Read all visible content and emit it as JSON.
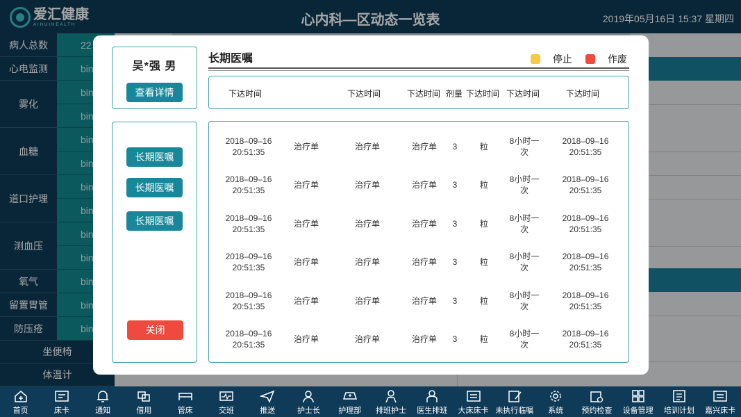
{
  "header": {
    "logo_cn": "爱汇健康",
    "logo_en": "AIHUIHEALTH",
    "title": "心内科—区动态一览表",
    "datetime": "2019年05月16日 15:37 星期四"
  },
  "left_menu": {
    "rows": [
      {
        "label": "病人总数",
        "values": [
          "22"
        ]
      },
      {
        "label": "心电监测",
        "values": [
          "bin"
        ]
      },
      {
        "label": "雾化",
        "values": [
          "bin",
          "bin"
        ]
      },
      {
        "label": "血糖",
        "values": [
          "bin",
          "bin"
        ]
      },
      {
        "label": "道口护理",
        "values": [
          "bin",
          "bin"
        ]
      },
      {
        "label": "测血压",
        "values": [
          "bin",
          "bin"
        ]
      },
      {
        "label": "氧气",
        "values": [
          "bin"
        ]
      },
      {
        "label": "留置胃管",
        "values": [
          "bin"
        ]
      },
      {
        "label": "防压疮",
        "values": [
          "bin"
        ]
      }
    ],
    "wide_rows": [
      "坐便椅",
      "体温计"
    ]
  },
  "modal": {
    "patient": "吴*强  男",
    "detail_button": "查看详情",
    "side_buttons": [
      "长期医嘱",
      "长期医嘱",
      "长期医嘱"
    ],
    "close_button": "关闭",
    "section_title": "长期医嘱",
    "legend": [
      {
        "label": "停止",
        "color": "#f7c948"
      },
      {
        "label": "作废",
        "color": "#ee4a3e"
      }
    ],
    "columns": [
      "下达时间",
      "下达时间",
      "下达时间",
      "剂量",
      "下达时间",
      "下达时间",
      "下达时间"
    ],
    "rows": [
      {
        "c1a": "2018–09–16",
        "c1b": "20:51:35",
        "c2": "治疗单",
        "c3": "治疗单",
        "c4": "治疗单",
        "c5": "3",
        "c6": "粒",
        "c7a": "8小时一",
        "c7b": "次",
        "c8a": "2018–09–16",
        "c8b": "20:51:35"
      },
      {
        "c1a": "2018–09–16",
        "c1b": "20:51:35",
        "c2": "治疗单",
        "c3": "治疗单",
        "c4": "治疗单",
        "c5": "3",
        "c6": "粒",
        "c7a": "8小时一",
        "c7b": "次",
        "c8a": "2018–09–16",
        "c8b": "20:51:35"
      },
      {
        "c1a": "2018–09–16",
        "c1b": "20:51:35",
        "c2": "治疗单",
        "c3": "治疗单",
        "c4": "治疗单",
        "c5": "3",
        "c6": "粒",
        "c7a": "8小时一",
        "c7b": "次",
        "c8a": "2018–09–16",
        "c8b": "20:51:35"
      },
      {
        "c1a": "2018–09–16",
        "c1b": "20:51:35",
        "c2": "治疗单",
        "c3": "治疗单",
        "c4": "治疗单",
        "c5": "3",
        "c6": "粒",
        "c7a": "8小时一",
        "c7b": "次",
        "c8a": "2018–09–16",
        "c8b": "20:51:35"
      },
      {
        "c1a": "2018–09–16",
        "c1b": "20:51:35",
        "c2": "治疗单",
        "c3": "治疗单",
        "c4": "治疗单",
        "c5": "3",
        "c6": "粒",
        "c7a": "8小时一",
        "c7b": "次",
        "c8a": "2018–09–16",
        "c8b": "20:51:35"
      },
      {
        "c1a": "2018–09–16",
        "c1b": "20:51:35",
        "c2": "治疗单",
        "c3": "治疗单",
        "c4": "治疗单",
        "c5": "3",
        "c6": "粒",
        "c7a": "8小时一",
        "c7b": "次",
        "c8a": "2018–09–16",
        "c8b": "20:51:35"
      }
    ]
  },
  "bottom_nav": [
    {
      "label": "首页",
      "icon": "home-icon"
    },
    {
      "label": "床卡",
      "icon": "bed-card-icon"
    },
    {
      "label": "通知",
      "icon": "bell-icon"
    },
    {
      "label": "借用",
      "icon": "borrow-icon"
    },
    {
      "label": "管床",
      "icon": "bed-icon"
    },
    {
      "label": "交班",
      "icon": "monitor-icon"
    },
    {
      "label": "推送",
      "icon": "send-icon"
    },
    {
      "label": "护士长",
      "icon": "head-nurse-icon"
    },
    {
      "label": "护理部",
      "icon": "nursing-cap-icon"
    },
    {
      "label": "排班护士",
      "icon": "nurse-schedule-icon"
    },
    {
      "label": "医生排班",
      "icon": "doctor-schedule-icon"
    },
    {
      "label": "大床床卡",
      "icon": "large-bed-card-icon"
    },
    {
      "label": "未执行临嘱",
      "icon": "pending-order-icon"
    },
    {
      "label": "系统",
      "icon": "gear-icon"
    },
    {
      "label": "预约检查",
      "icon": "appointment-icon"
    },
    {
      "label": "设备管理",
      "icon": "grid-icon"
    },
    {
      "label": "培训计划",
      "icon": "training-icon"
    },
    {
      "label": "嘉兴床卡",
      "icon": "jiaxing-bed-card-icon"
    }
  ]
}
